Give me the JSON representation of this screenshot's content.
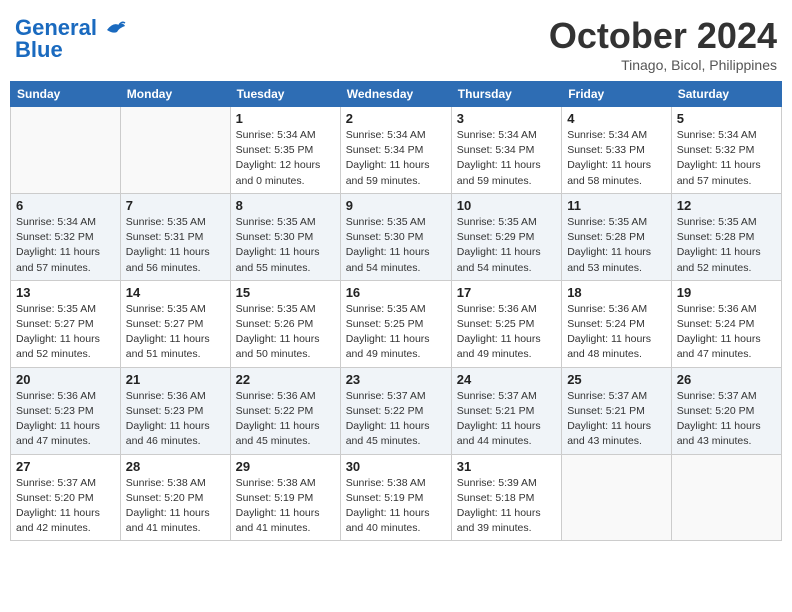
{
  "header": {
    "logo_line1": "General",
    "logo_line2": "Blue",
    "month": "October 2024",
    "location": "Tinago, Bicol, Philippines"
  },
  "weekdays": [
    "Sunday",
    "Monday",
    "Tuesday",
    "Wednesday",
    "Thursday",
    "Friday",
    "Saturday"
  ],
  "weeks": [
    [
      {
        "day": "",
        "info": ""
      },
      {
        "day": "",
        "info": ""
      },
      {
        "day": "1",
        "info": "Sunrise: 5:34 AM\nSunset: 5:35 PM\nDaylight: 12 hours\nand 0 minutes."
      },
      {
        "day": "2",
        "info": "Sunrise: 5:34 AM\nSunset: 5:34 PM\nDaylight: 11 hours\nand 59 minutes."
      },
      {
        "day": "3",
        "info": "Sunrise: 5:34 AM\nSunset: 5:34 PM\nDaylight: 11 hours\nand 59 minutes."
      },
      {
        "day": "4",
        "info": "Sunrise: 5:34 AM\nSunset: 5:33 PM\nDaylight: 11 hours\nand 58 minutes."
      },
      {
        "day": "5",
        "info": "Sunrise: 5:34 AM\nSunset: 5:32 PM\nDaylight: 11 hours\nand 57 minutes."
      }
    ],
    [
      {
        "day": "6",
        "info": "Sunrise: 5:34 AM\nSunset: 5:32 PM\nDaylight: 11 hours\nand 57 minutes."
      },
      {
        "day": "7",
        "info": "Sunrise: 5:35 AM\nSunset: 5:31 PM\nDaylight: 11 hours\nand 56 minutes."
      },
      {
        "day": "8",
        "info": "Sunrise: 5:35 AM\nSunset: 5:30 PM\nDaylight: 11 hours\nand 55 minutes."
      },
      {
        "day": "9",
        "info": "Sunrise: 5:35 AM\nSunset: 5:30 PM\nDaylight: 11 hours\nand 54 minutes."
      },
      {
        "day": "10",
        "info": "Sunrise: 5:35 AM\nSunset: 5:29 PM\nDaylight: 11 hours\nand 54 minutes."
      },
      {
        "day": "11",
        "info": "Sunrise: 5:35 AM\nSunset: 5:28 PM\nDaylight: 11 hours\nand 53 minutes."
      },
      {
        "day": "12",
        "info": "Sunrise: 5:35 AM\nSunset: 5:28 PM\nDaylight: 11 hours\nand 52 minutes."
      }
    ],
    [
      {
        "day": "13",
        "info": "Sunrise: 5:35 AM\nSunset: 5:27 PM\nDaylight: 11 hours\nand 52 minutes."
      },
      {
        "day": "14",
        "info": "Sunrise: 5:35 AM\nSunset: 5:27 PM\nDaylight: 11 hours\nand 51 minutes."
      },
      {
        "day": "15",
        "info": "Sunrise: 5:35 AM\nSunset: 5:26 PM\nDaylight: 11 hours\nand 50 minutes."
      },
      {
        "day": "16",
        "info": "Sunrise: 5:35 AM\nSunset: 5:25 PM\nDaylight: 11 hours\nand 49 minutes."
      },
      {
        "day": "17",
        "info": "Sunrise: 5:36 AM\nSunset: 5:25 PM\nDaylight: 11 hours\nand 49 minutes."
      },
      {
        "day": "18",
        "info": "Sunrise: 5:36 AM\nSunset: 5:24 PM\nDaylight: 11 hours\nand 48 minutes."
      },
      {
        "day": "19",
        "info": "Sunrise: 5:36 AM\nSunset: 5:24 PM\nDaylight: 11 hours\nand 47 minutes."
      }
    ],
    [
      {
        "day": "20",
        "info": "Sunrise: 5:36 AM\nSunset: 5:23 PM\nDaylight: 11 hours\nand 47 minutes."
      },
      {
        "day": "21",
        "info": "Sunrise: 5:36 AM\nSunset: 5:23 PM\nDaylight: 11 hours\nand 46 minutes."
      },
      {
        "day": "22",
        "info": "Sunrise: 5:36 AM\nSunset: 5:22 PM\nDaylight: 11 hours\nand 45 minutes."
      },
      {
        "day": "23",
        "info": "Sunrise: 5:37 AM\nSunset: 5:22 PM\nDaylight: 11 hours\nand 45 minutes."
      },
      {
        "day": "24",
        "info": "Sunrise: 5:37 AM\nSunset: 5:21 PM\nDaylight: 11 hours\nand 44 minutes."
      },
      {
        "day": "25",
        "info": "Sunrise: 5:37 AM\nSunset: 5:21 PM\nDaylight: 11 hours\nand 43 minutes."
      },
      {
        "day": "26",
        "info": "Sunrise: 5:37 AM\nSunset: 5:20 PM\nDaylight: 11 hours\nand 43 minutes."
      }
    ],
    [
      {
        "day": "27",
        "info": "Sunrise: 5:37 AM\nSunset: 5:20 PM\nDaylight: 11 hours\nand 42 minutes."
      },
      {
        "day": "28",
        "info": "Sunrise: 5:38 AM\nSunset: 5:20 PM\nDaylight: 11 hours\nand 41 minutes."
      },
      {
        "day": "29",
        "info": "Sunrise: 5:38 AM\nSunset: 5:19 PM\nDaylight: 11 hours\nand 41 minutes."
      },
      {
        "day": "30",
        "info": "Sunrise: 5:38 AM\nSunset: 5:19 PM\nDaylight: 11 hours\nand 40 minutes."
      },
      {
        "day": "31",
        "info": "Sunrise: 5:39 AM\nSunset: 5:18 PM\nDaylight: 11 hours\nand 39 minutes."
      },
      {
        "day": "",
        "info": ""
      },
      {
        "day": "",
        "info": ""
      }
    ]
  ]
}
